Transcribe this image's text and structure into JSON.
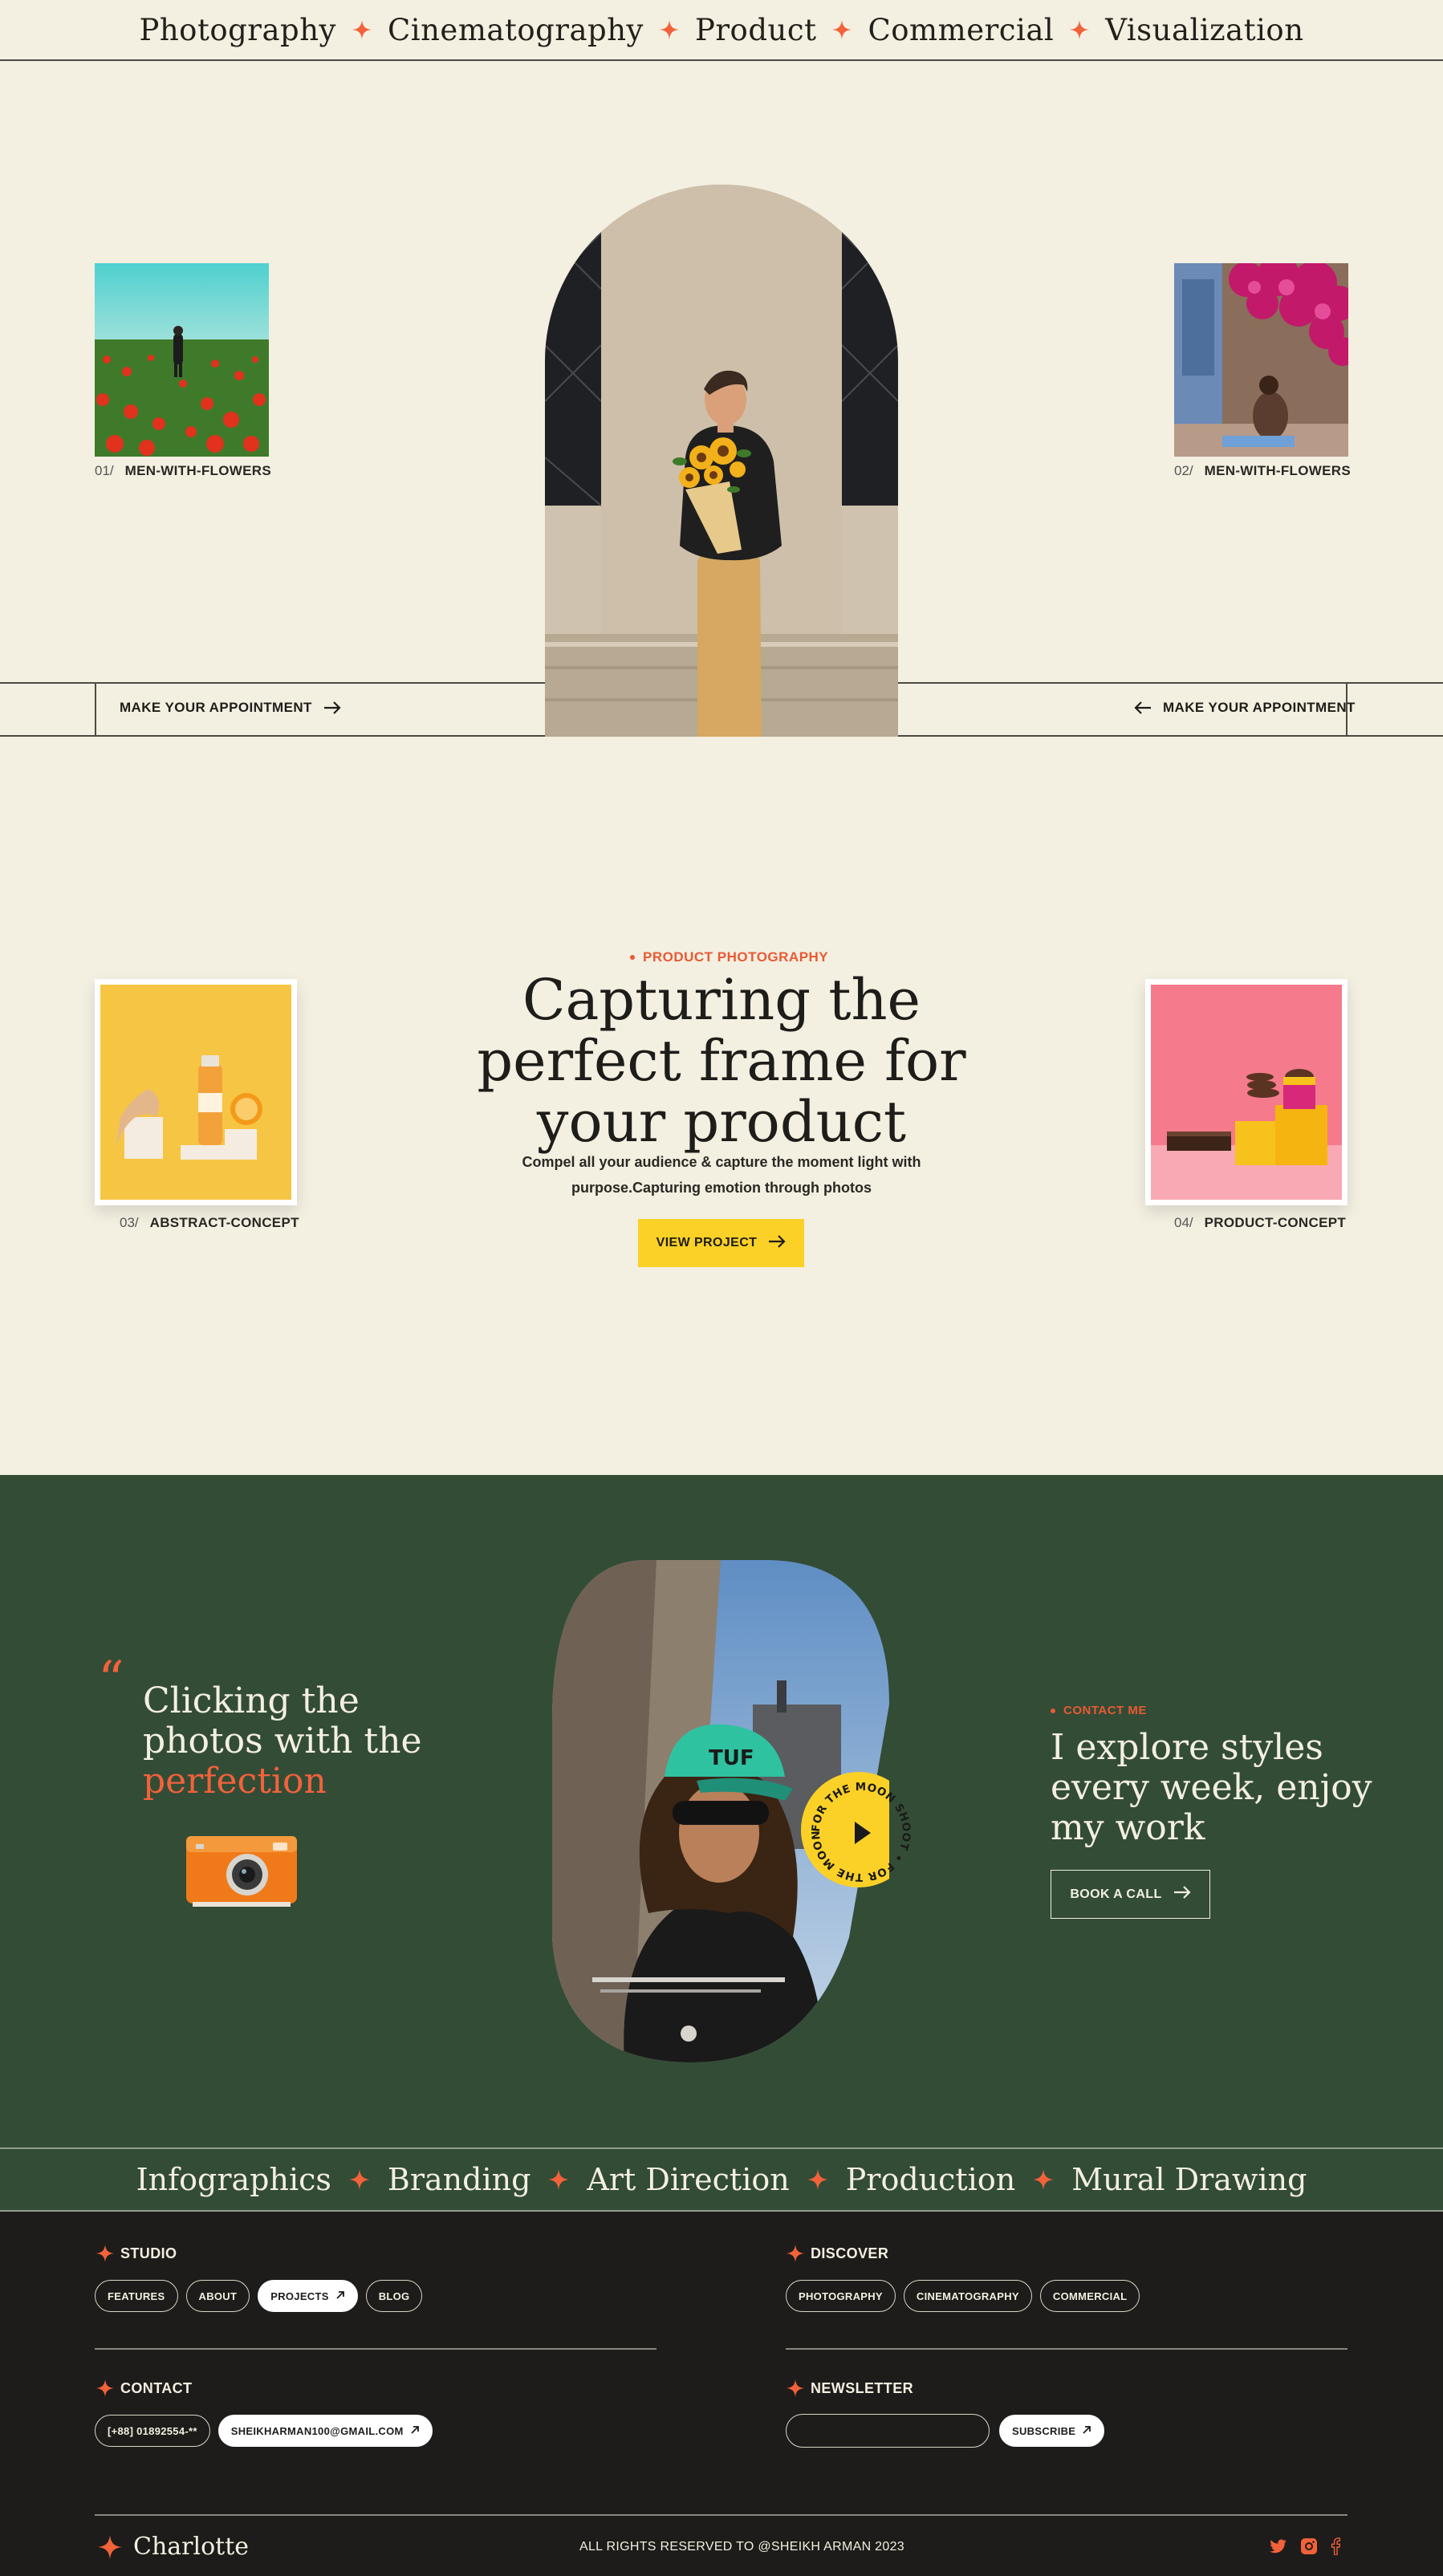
{
  "marquee_top": {
    "items": [
      "Photography",
      "Cinematography",
      "Product",
      "Commercial",
      "Visualization"
    ]
  },
  "hero": {
    "thumb_left": {
      "num": "01/",
      "label": "MEN-WITH-FLOWERS"
    },
    "thumb_right": {
      "num": "02/",
      "label": "MEN-WITH-FLOWERS"
    },
    "appointment_left": "MAKE YOUR APPOINTMENT",
    "appointment_right": "MAKE YOUR APPOINTMENT"
  },
  "product": {
    "tag": "PRODUCT PHOTOGRAPHY",
    "title_lines": [
      "Capturing the",
      "perfect frame for",
      "your product"
    ],
    "desc_lines": [
      "Compel all your audience & capture the moment light with",
      "purpose.Capturing emotion through photos"
    ],
    "button": "VIEW PROJECT",
    "card_left": {
      "num": "03/",
      "label": "ABSTRACT-CONCEPT"
    },
    "card_right": {
      "num": "04/",
      "label": "PRODUCT-CONCEPT"
    }
  },
  "feature": {
    "quote_mark": "“",
    "heading_line1": "Clicking the",
    "heading_line2": "photos with the",
    "heading_highlight": "perfection",
    "badge_text": "FOR THE MOON SHOOT • FOR THE MOON SHOOT •",
    "tag": "CONTACT ME",
    "right_lines": [
      "I explore styles",
      "every week, enjoy",
      "my work"
    ],
    "button": "BOOK A CALL"
  },
  "marquee_bottom": {
    "items": [
      "Infographics",
      "Branding",
      "Art Direction",
      "Production",
      "Mural Drawing"
    ]
  },
  "footer": {
    "studio": {
      "title": "STUDIO",
      "links": [
        "FEATURES",
        "ABOUT",
        "PROJECTS",
        "BLOG"
      ],
      "active": "PROJECTS"
    },
    "discover": {
      "title": "DISCOVER",
      "links": [
        "PHOTOGRAPHY",
        "CINEMATOGRAPHY",
        "COMMERCIAL"
      ]
    },
    "contact": {
      "title": "CONTACT",
      "phone": "[+88] 01892554-**",
      "email": "SHEIKHARMAN100@GMAIL.COM"
    },
    "newsletter": {
      "title": "NEWSLETTER",
      "input_value": "",
      "button": "SUBSCRIBE"
    },
    "brand": "Charlotte",
    "copyright": "ALL RIGHTS RESERVED TO @SHEIKH ARMAN 2023",
    "social_icons": [
      "twitter-icon",
      "instagram-icon",
      "facebook-icon"
    ]
  },
  "colors": {
    "cream": "#f3efe1",
    "accent": "#f2623a",
    "green": "#334c36",
    "yellow": "#fbd127",
    "dark": "#1e1c1a"
  }
}
